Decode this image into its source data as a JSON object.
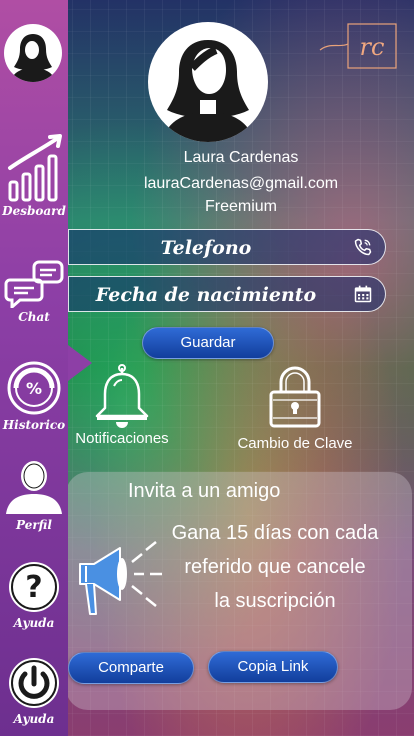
{
  "sidebar": {
    "items": [
      {
        "label": "Desboard"
      },
      {
        "label": "Chat"
      },
      {
        "label": "Historico"
      },
      {
        "label": "Perfil"
      },
      {
        "label": "Ayuda"
      },
      {
        "label": "Ayuda"
      }
    ]
  },
  "logo": {
    "text": "rc"
  },
  "profile": {
    "name": "Laura Cardenas",
    "email": "lauraCardenas@gmail.com",
    "plan": "Freemium"
  },
  "form": {
    "phone_placeholder": "Telefono",
    "birthdate_placeholder": "Fecha de nacimiento",
    "save_label": "Guardar"
  },
  "settings": {
    "notifications_label": "Notificaciones",
    "change_password_label": "Cambio de Clave"
  },
  "invite": {
    "title": "Invita a un amigo",
    "line1": "Gana 15 días con cada",
    "line2": "referido que cancele",
    "line3": "la suscripción",
    "share_label": "Comparte",
    "copy_label": "Copia Link"
  },
  "colors": {
    "sidebar": "#8d3fa6",
    "button": "#1f4fb8"
  }
}
